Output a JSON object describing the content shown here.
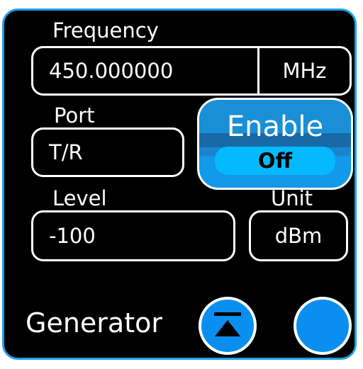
{
  "frequency": {
    "label": "Frequency",
    "value": "450.000000",
    "unit": "MHz"
  },
  "port": {
    "label": "Port",
    "value": "T/R"
  },
  "enable": {
    "label": "Enable",
    "state": "Off"
  },
  "level": {
    "label": "Level",
    "value": "-100"
  },
  "unit": {
    "label": "Unit",
    "value": "dBm"
  },
  "generator": {
    "label": "Generator",
    "collapse_icon": "collapse-up-icon",
    "round_button_icon": "circle-icon"
  },
  "colors": {
    "panel_border": "#1ea0e6",
    "background": "#000000",
    "accent": "#0a8ff0",
    "text": "#ffffff"
  }
}
